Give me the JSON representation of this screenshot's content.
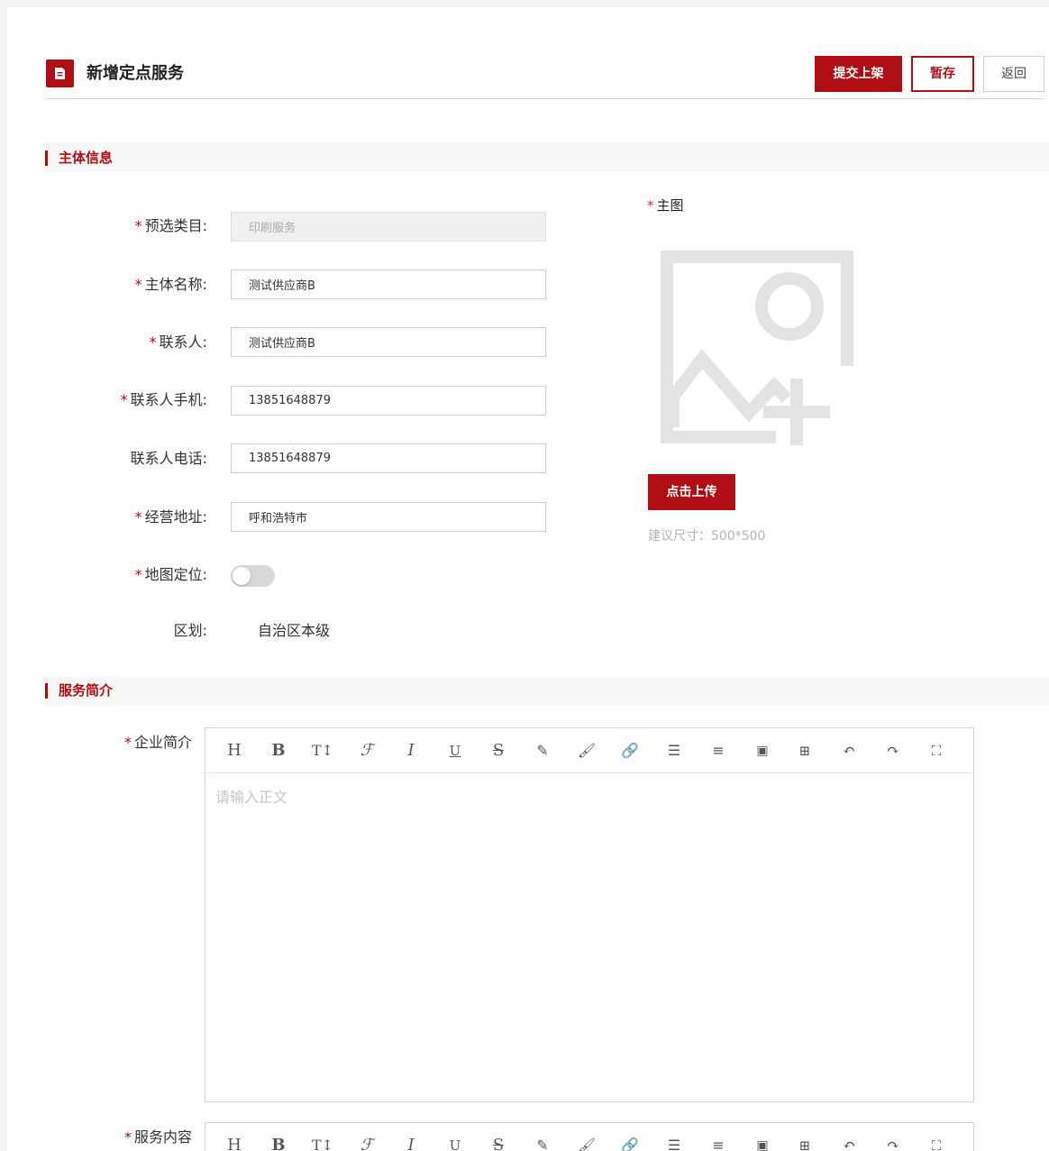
{
  "header": {
    "title": "新增定点服务",
    "submit_label": "提交上架",
    "draft_label": "暂存",
    "back_label": "返回"
  },
  "sections": {
    "subject_info": "主体信息",
    "service_intro": "服务简介"
  },
  "form": {
    "required_mark": "*",
    "category": {
      "label": "预选类目:",
      "value": "印刷服务",
      "required": true
    },
    "subject_name": {
      "label": "主体名称:",
      "value": "测试供应商B",
      "required": true
    },
    "contact": {
      "label": "联系人:",
      "value": "测试供应商B",
      "required": true
    },
    "contact_mobile": {
      "label": "联系人手机:",
      "value": "13851648879",
      "required": true
    },
    "contact_phone": {
      "label": "联系人电话:",
      "value": "13851648879",
      "required": false
    },
    "address": {
      "label": "经营地址:",
      "value": "呼和浩特市",
      "required": true
    },
    "map_location": {
      "label": "地图定位:",
      "enabled": false,
      "required": true
    },
    "district": {
      "label": "区划:",
      "value": "自治区本级"
    }
  },
  "main_image": {
    "label": "主图",
    "upload_label": "点击上传",
    "size_hint": "建议尺寸：500*500"
  },
  "editors": {
    "company_intro": {
      "label": "企业简介",
      "placeholder": "请输入正文"
    },
    "service_content": {
      "label": "服务内容"
    }
  },
  "colors": {
    "accent": "#b00d14",
    "toggle_off": "#d8d8d8",
    "placeholder": "#c5c5c5"
  }
}
